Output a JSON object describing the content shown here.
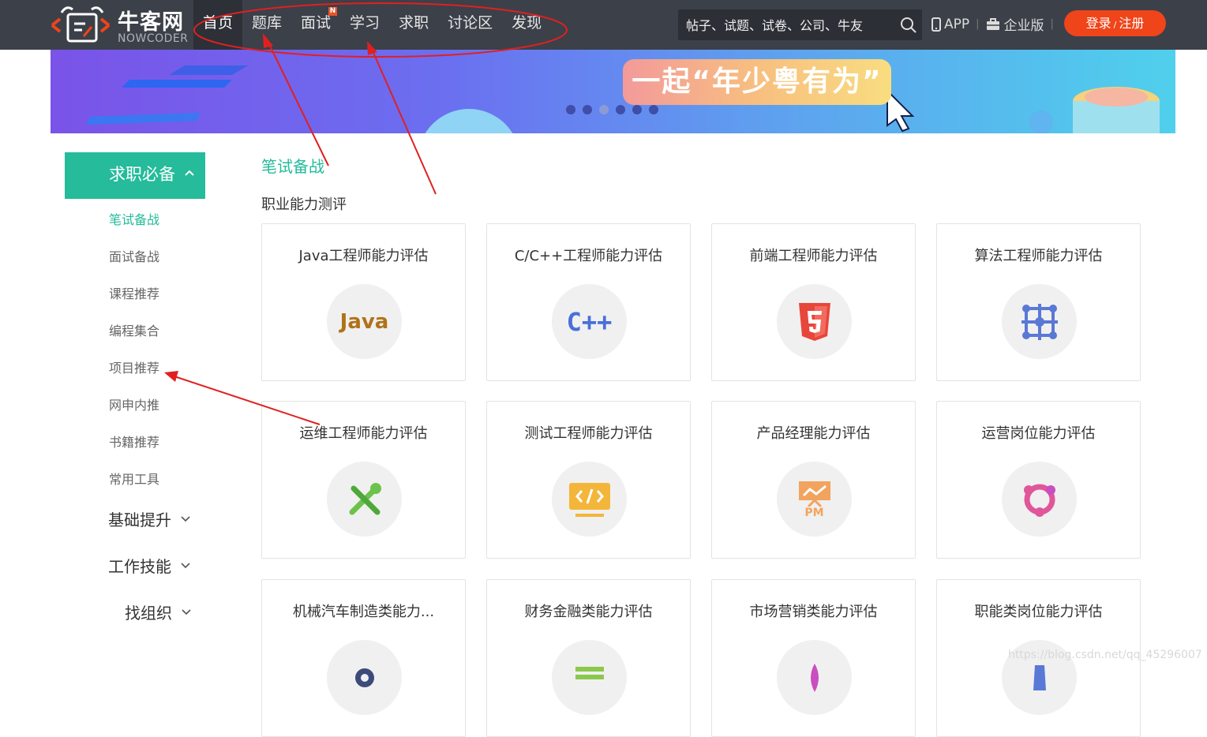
{
  "header": {
    "logo_title": "牛客网",
    "logo_sub": "NOWCODER",
    "nav": [
      {
        "label": "首页",
        "active": true
      },
      {
        "label": "题库"
      },
      {
        "label": "面试",
        "badge": "N"
      },
      {
        "label": "学习"
      },
      {
        "label": "求职"
      },
      {
        "label": "讨论区"
      },
      {
        "label": "发现"
      }
    ],
    "search_placeholder": "帖子、试题、试卷、公司、牛友",
    "app_label": "APP",
    "enterprise_label": "企业版",
    "login_label": "登录",
    "register_label": "注册"
  },
  "banner": {
    "title": "一起“年少粤有为”",
    "slide_count": 6,
    "active_slide": 3
  },
  "sidebar": {
    "head": "求职必备",
    "items": [
      "笔试备战",
      "面试备战",
      "课程推荐",
      "编程集合",
      "项目推荐",
      "网申内推",
      "书籍推荐",
      "常用工具"
    ],
    "groups": [
      "基础提升",
      "工作技能",
      "找组织"
    ]
  },
  "main": {
    "section_title": "笔试备战",
    "sub_title": "职业能力测评",
    "cards": [
      {
        "title": "Java工程师能力评估",
        "icon": "java-icon"
      },
      {
        "title": "C/C++工程师能力评估",
        "icon": "cpp-icon"
      },
      {
        "title": "前端工程师能力评估",
        "icon": "html5-icon"
      },
      {
        "title": "算法工程师能力评估",
        "icon": "algorithm-icon"
      },
      {
        "title": "运维工程师能力评估",
        "icon": "tools-icon"
      },
      {
        "title": "测试工程师能力评估",
        "icon": "code-icon"
      },
      {
        "title": "产品经理能力评估",
        "icon": "pm-icon"
      },
      {
        "title": "运营岗位能力评估",
        "icon": "operation-icon"
      },
      {
        "title": "机械汽车制造类能力...",
        "icon": "gear-icon"
      },
      {
        "title": "财务金融类能力评估",
        "icon": "finance-icon"
      },
      {
        "title": "市场营销类能力评估",
        "icon": "marketing-icon"
      },
      {
        "title": "职能类岗位能力评估",
        "icon": "function-icon"
      }
    ],
    "icon_texts": {
      "java": "Java",
      "cpp": "C++",
      "pm": "PM"
    }
  },
  "watermark": "https://blog.csdn.net/qq_45296007",
  "colors": {
    "accent": "#25bb9b",
    "topbar": "#3c4049",
    "login": "#f0441a",
    "annotation": "#e02020"
  }
}
